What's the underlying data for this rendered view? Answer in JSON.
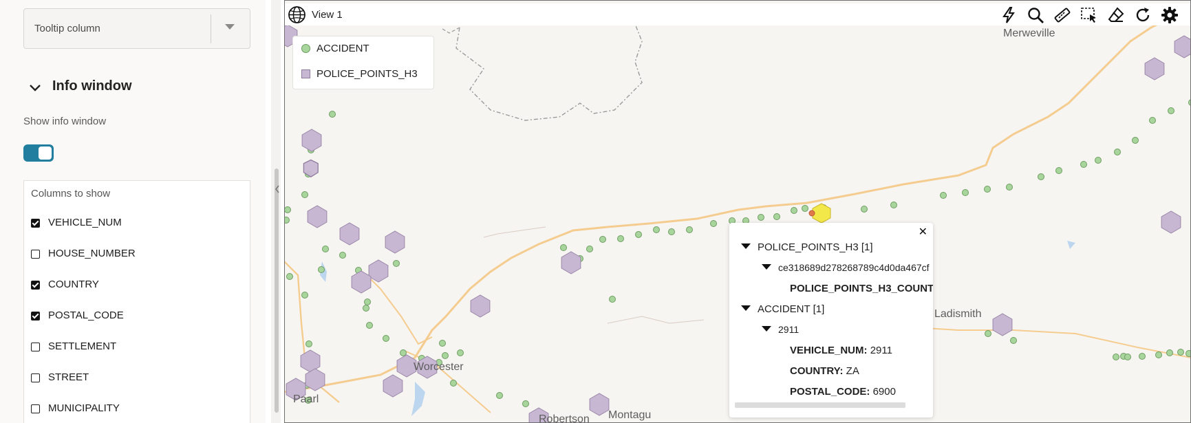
{
  "left_panel": {
    "tooltip_select_label": "Tooltip column",
    "info_section_title": "Info window",
    "show_info_label": "Show info window",
    "show_info_enabled": true,
    "columns_title": "Columns to show",
    "columns": [
      {
        "label": "VEHICLE_NUM",
        "checked": true
      },
      {
        "label": "HOUSE_NUMBER",
        "checked": false
      },
      {
        "label": "COUNTRY",
        "checked": true
      },
      {
        "label": "POSTAL_CODE",
        "checked": true
      },
      {
        "label": "SETTLEMENT",
        "checked": false
      },
      {
        "label": "STREET",
        "checked": false
      },
      {
        "label": "MUNICIPALITY",
        "checked": false
      }
    ]
  },
  "map": {
    "view_title": "View 1",
    "tools": [
      "lightning-icon",
      "magnifier-icon",
      "ruler-icon",
      "box-select-icon",
      "eraser-icon",
      "refresh-icon",
      "gear-icon"
    ],
    "places": [
      "Merweville",
      "Ladismith",
      "Worcester",
      "Robertson",
      "Montagu",
      "Paarl"
    ],
    "legend": [
      {
        "label": "ACCIDENT",
        "symbol": "circle",
        "color": "#a8d59c"
      },
      {
        "label": "POLICE_POINTS_H3",
        "symbol": "square",
        "color": "#c8b7d3"
      }
    ],
    "colors": {
      "accident": "#a8d59c",
      "police_hex": "#c8b7d3",
      "selected_hex": "#f3e84a",
      "road": "#f5cc8f",
      "accent": "#227e9e"
    }
  },
  "info_window": {
    "group1_title": "POLICE_POINTS_H3 [1]",
    "group1_id": "ce318689d278268789c4d0da467cf",
    "group1_field": "POLICE_POINTS_H3_COUNT",
    "group2_title": "ACCIDENT [1]",
    "group2_id": "2911",
    "fields": [
      {
        "key": "VEHICLE_NUM:",
        "value": "2911"
      },
      {
        "key": "COUNTRY:",
        "value": "ZA"
      },
      {
        "key": "POSTAL_CODE:",
        "value": "6900"
      }
    ]
  }
}
